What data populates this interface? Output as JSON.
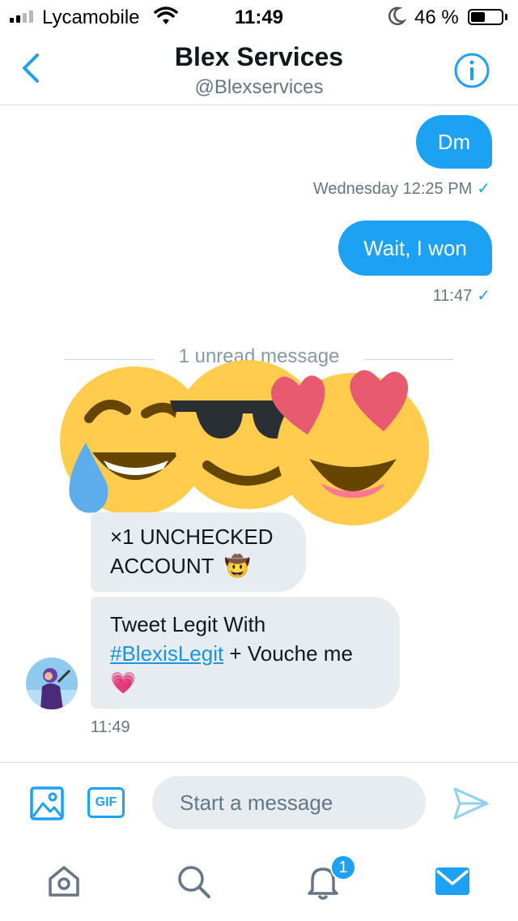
{
  "status_bar": {
    "carrier": "Lycamobile",
    "time": "11:49",
    "battery_percent": "46 %",
    "battery_level": 0.46,
    "signal_bars": 4,
    "signal_bars_active": 2
  },
  "header": {
    "title": "Blex Services",
    "handle": "@Blexservices"
  },
  "messages": {
    "sent": [
      {
        "text": "Dm",
        "meta": "Wednesday 12:25 PM",
        "check": "✓"
      },
      {
        "text": "Wait, I won",
        "meta": "11:47",
        "check": "✓"
      }
    ],
    "unread_divider": "1 unread message",
    "received_emojis": [
      "face-with-tears-of-joy",
      "smiling-face-with-sunglasses",
      "smiling-face-with-heart-eyes"
    ],
    "received": [
      {
        "line1": "×1 UNCHECKED",
        "line2": "ACCOUNT",
        "emoji": "🤠"
      },
      {
        "line1": "Tweet Legit With",
        "hashtag": "#BlexisLegit",
        "after_hashtag": " + Vouche me",
        "emoji": "💗"
      }
    ],
    "received_time": "11:49"
  },
  "composer": {
    "gif_label": "GIF",
    "placeholder": "Start a message"
  },
  "tabbar": {
    "notifications_badge": "1"
  },
  "colors": {
    "accent": "#1da1f2",
    "incoming_bubble": "#e6ecf0",
    "muted_text": "#657786",
    "divider": "#d6dbe0"
  }
}
